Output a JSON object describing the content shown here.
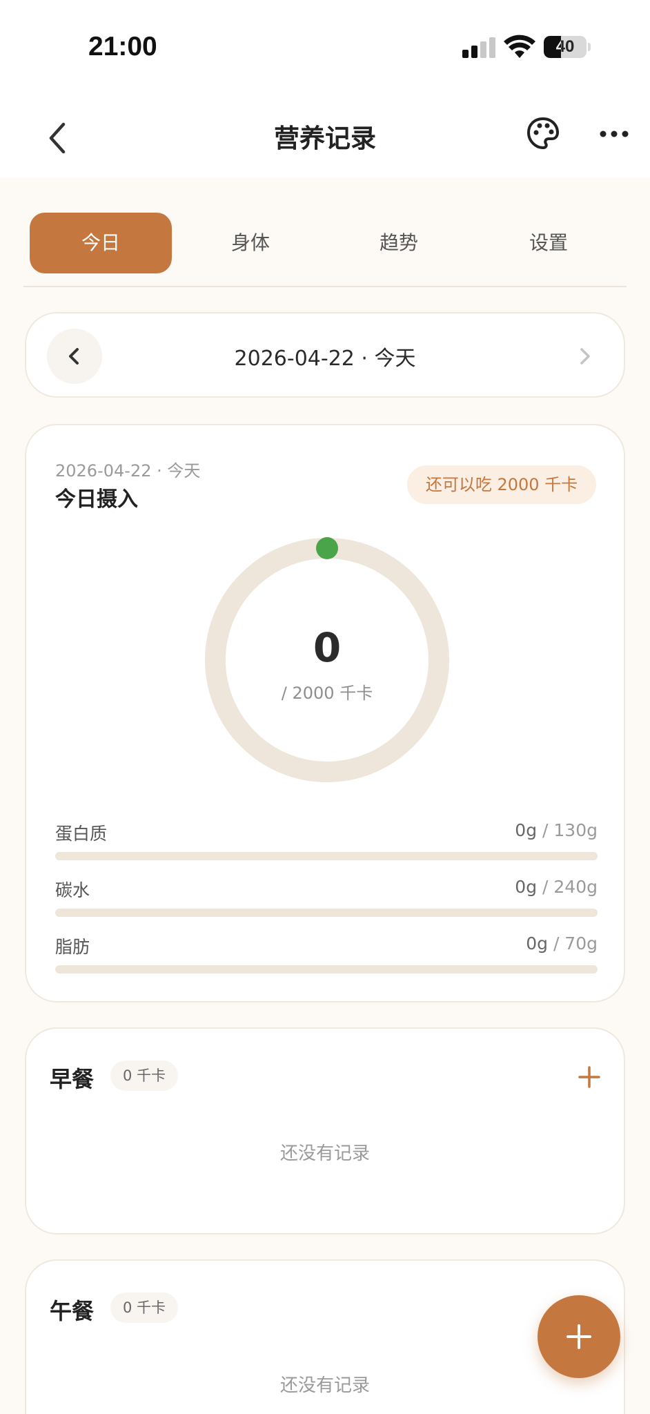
{
  "status_bar": {
    "time": "21:00",
    "battery": "40",
    "battery_level": 0.4
  },
  "nav": {
    "title": "营养记录"
  },
  "tabs": [
    {
      "label": "今日",
      "active": true
    },
    {
      "label": "身体",
      "active": false
    },
    {
      "label": "趋势",
      "active": false
    },
    {
      "label": "设置",
      "active": false
    }
  ],
  "date_selector": {
    "label": "2026-04-22 · 今天"
  },
  "intake": {
    "date": "2026-04-22 · 今天",
    "title": "今日摄入",
    "remaining": "还可以吃 2000 千卡",
    "consumed": "0",
    "goal": "/ 2000 千卡",
    "progress": 0,
    "macros": [
      {
        "name": "蛋白质",
        "value": "0g",
        "goal": "/ 130g",
        "progress": 0
      },
      {
        "name": "碳水",
        "value": "0g",
        "goal": "/ 240g",
        "progress": 0
      },
      {
        "name": "脂肪",
        "value": "0g",
        "goal": "/ 70g",
        "progress": 0
      }
    ]
  },
  "meals": [
    {
      "name": "早餐",
      "kcal": "0 千卡",
      "empty": "还没有记录"
    },
    {
      "name": "午餐",
      "kcal": "0 千卡",
      "empty": "还没有记录"
    }
  ],
  "colors": {
    "accent": "#c47840",
    "ring_track": "#eee6da",
    "ring_dot": "#4aa54a",
    "background": "#fdfaf6"
  }
}
